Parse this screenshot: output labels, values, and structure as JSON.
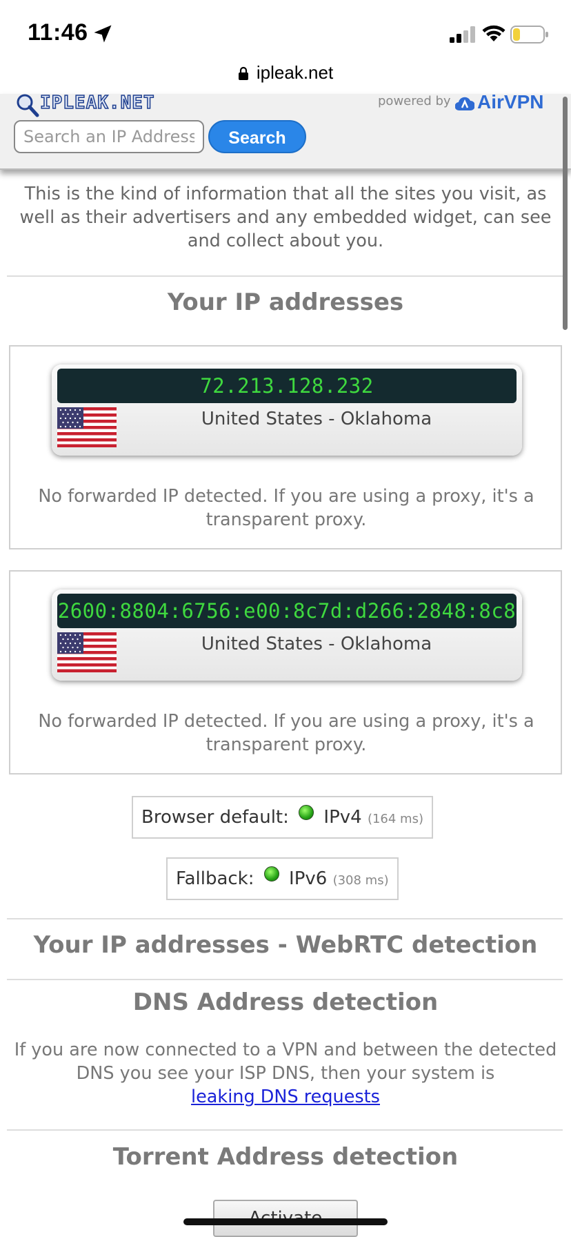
{
  "status_bar": {
    "time": "11:46",
    "icons": [
      "location-arrow-icon",
      "signal-icon",
      "wifi-icon",
      "battery-icon"
    ]
  },
  "browser": {
    "url": "ipleak.net",
    "icon": "lock-icon"
  },
  "header": {
    "logo_text": "IPLEAK.NET",
    "powered_by": "powered by",
    "sponsor": "AirVPN",
    "search_placeholder": "Search an IP Address",
    "search_button": "Search",
    "colors": {
      "search_button": "#2a86e8",
      "sponsor": "#2f6bd3"
    }
  },
  "intro": "This is the kind of information that all the sites you visit, as well as their advertisers and any embedded widget, can see and collect about you.",
  "ip_section": {
    "title": "Your IP addresses",
    "addresses": [
      {
        "ip": "72.213.128.232",
        "location": "United States - Oklahoma",
        "flag": "us-flag-icon",
        "note": "No forwarded IP detected. If you are using a proxy, it's a transparent proxy."
      },
      {
        "ip": "2600:8804:6756:e00:8c7d:d266:2848:8c8",
        "location": "United States - Oklahoma",
        "flag": "us-flag-icon",
        "note": "No forwarded IP detected. If you are using a proxy, it's a transparent proxy."
      }
    ],
    "browser_default": {
      "label": "Browser default:",
      "protocol": "IPv4",
      "latency": "(164 ms)"
    },
    "fallback": {
      "label": "Fallback:",
      "protocol": "IPv6",
      "latency": "(308 ms)"
    }
  },
  "webrtc_section": {
    "title": "Your IP addresses - WebRTC detection"
  },
  "dns_section": {
    "title": "DNS Address detection",
    "text": "If you are now connected to a VPN and between the detected DNS you see your ISP DNS, then your system is",
    "link": "leaking DNS requests"
  },
  "torrent_section": {
    "title": "Torrent Address detection",
    "button": "Activate"
  }
}
